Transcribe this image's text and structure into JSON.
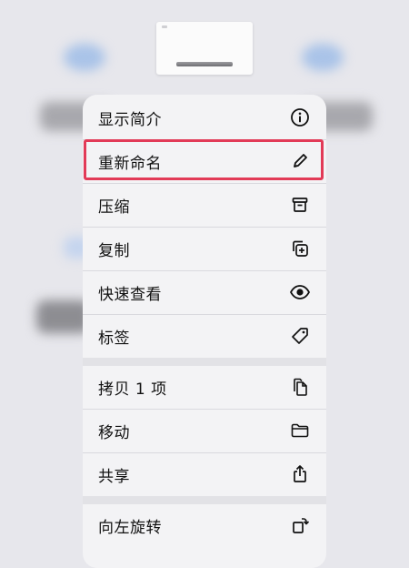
{
  "menu": {
    "items": [
      {
        "label": "显示简介",
        "icon": "info-icon"
      },
      {
        "label": "重新命名",
        "icon": "pencil-icon"
      },
      {
        "label": "压缩",
        "icon": "archive-box-icon"
      },
      {
        "label": "复制",
        "icon": "duplicate-plus-icon"
      },
      {
        "label": "快速查看",
        "icon": "eye-icon"
      },
      {
        "label": "标签",
        "icon": "tag-icon"
      },
      {
        "label": "拷贝 1 项",
        "icon": "copy-document-icon"
      },
      {
        "label": "移动",
        "icon": "folder-icon"
      },
      {
        "label": "共享",
        "icon": "share-icon"
      },
      {
        "label": "向左旋转",
        "icon": "rotate-left-icon"
      }
    ],
    "highlighted_item": "重新命名",
    "highlight_color": "#e23a57"
  }
}
